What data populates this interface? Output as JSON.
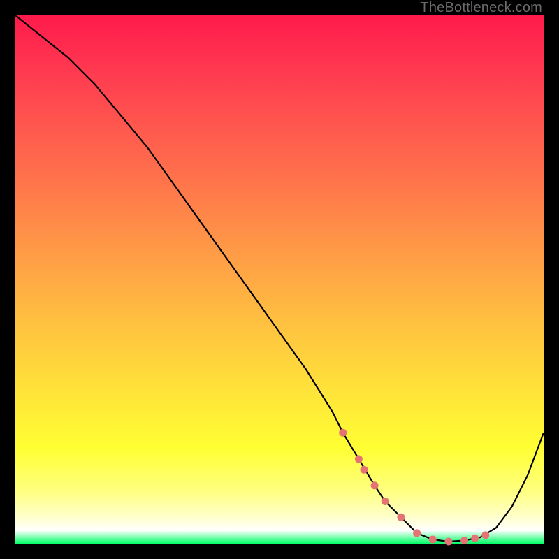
{
  "watermark": "TheBottleneck.com",
  "chart_data": {
    "type": "line",
    "title": "",
    "xlabel": "",
    "ylabel": "",
    "xlim": [
      0,
      100
    ],
    "ylim": [
      0,
      100
    ],
    "series": [
      {
        "name": "bottleneck-curve",
        "x": [
          0,
          5,
          10,
          15,
          20,
          25,
          30,
          35,
          40,
          45,
          50,
          55,
          60,
          62,
          65,
          68,
          70,
          73,
          76,
          79,
          82,
          85,
          88,
          91,
          94,
          97,
          100
        ],
        "y": [
          100,
          96,
          92,
          87,
          81,
          75,
          68,
          61,
          54,
          47,
          40,
          33,
          25,
          21,
          16,
          11,
          8,
          5,
          2,
          0.8,
          0.4,
          0.6,
          1.2,
          3,
          7,
          13,
          21
        ]
      }
    ],
    "markers": {
      "name": "highlight-dots",
      "color": "#e57373",
      "x": [
        62,
        65,
        66,
        68,
        70,
        73,
        76,
        79,
        82,
        85,
        87,
        89
      ],
      "y": [
        21,
        16,
        14,
        11,
        8,
        5,
        2,
        0.8,
        0.4,
        0.6,
        1.0,
        1.6
      ]
    }
  }
}
